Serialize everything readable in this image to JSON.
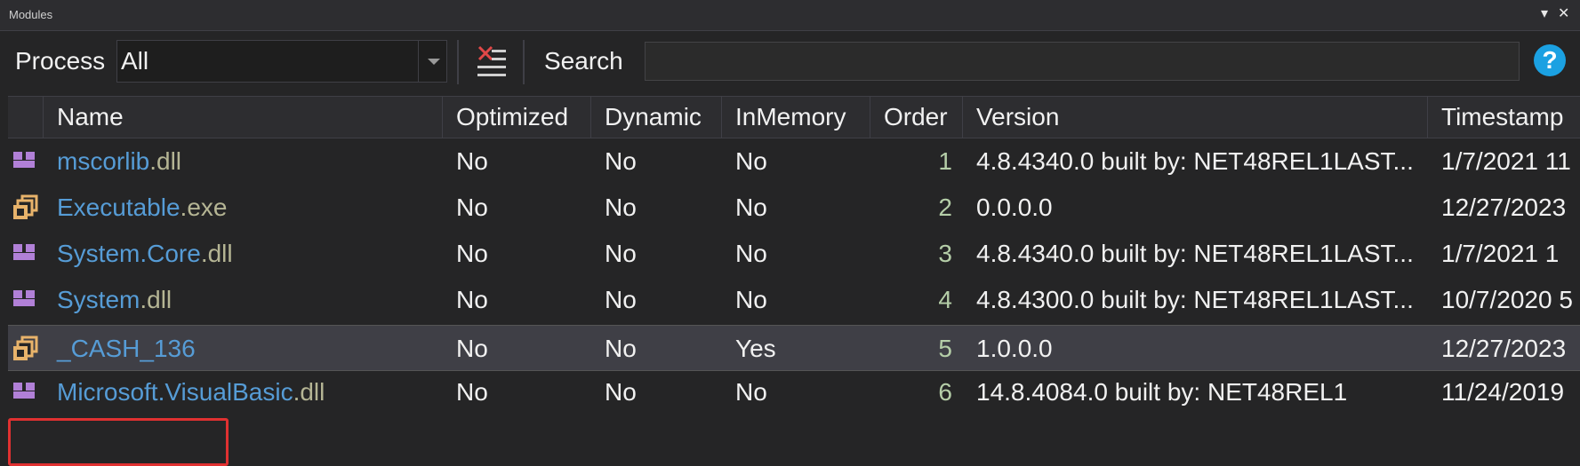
{
  "window": {
    "title": "Modules",
    "dropdown_glyph": "▾",
    "close_glyph": "✕"
  },
  "toolbar": {
    "process_label": "Process",
    "process_value": "All",
    "search_label": "Search",
    "search_value": "",
    "help_glyph": "?"
  },
  "columns": [
    "Name",
    "Optimized",
    "Dynamic",
    "InMemory",
    "Order",
    "Version",
    "Timestamp"
  ],
  "rows": [
    {
      "icon": "dll-icon",
      "name_base": "mscorlib",
      "name_ext": ".dll",
      "optimized": "No",
      "dynamic": "No",
      "inmemory": "No",
      "order": "1",
      "version": "4.8.4340.0 built by: NET48REL1LAST...",
      "timestamp": "1/7/2021 11"
    },
    {
      "icon": "exe-icon",
      "name_base": "Executable",
      "name_ext": ".exe",
      "optimized": "No",
      "dynamic": "No",
      "inmemory": "No",
      "order": "2",
      "version": "0.0.0.0",
      "timestamp": "12/27/2023"
    },
    {
      "icon": "dll-icon",
      "name_base": "System.Core",
      "name_ext": ".dll",
      "optimized": "No",
      "dynamic": "No",
      "inmemory": "No",
      "order": "3",
      "version": "4.8.4340.0 built by: NET48REL1LAST...",
      "timestamp": "1/7/2021 1"
    },
    {
      "icon": "dll-icon",
      "name_base": "System",
      "name_ext": ".dll",
      "optimized": "No",
      "dynamic": "No",
      "inmemory": "No",
      "order": "4",
      "version": "4.8.4300.0 built by: NET48REL1LAST...",
      "timestamp": "10/7/2020 5"
    },
    {
      "icon": "exe-icon",
      "name_base": "_CASH_136",
      "name_ext": "",
      "optimized": "No",
      "dynamic": "No",
      "inmemory": "Yes",
      "order": "5",
      "version": "1.0.0.0",
      "timestamp": "12/27/2023",
      "selected": true
    },
    {
      "icon": "dll-icon",
      "name_base": "Microsoft.VisualBasic",
      "name_ext": ".dll",
      "optimized": "No",
      "dynamic": "No",
      "inmemory": "No",
      "order": "6",
      "version": "14.8.4084.0 built by: NET48REL1",
      "timestamp": "11/24/2019"
    }
  ],
  "colors": {
    "name_base": "#569cd6",
    "name_ext": "#b5b594",
    "order": "#b5cea8",
    "selection_outline": "#e03131"
  }
}
